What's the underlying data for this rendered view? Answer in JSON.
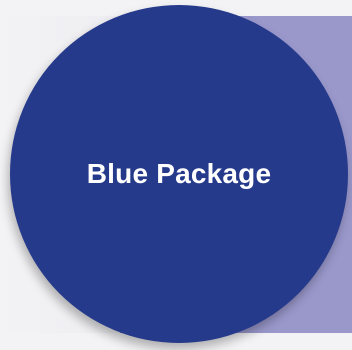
{
  "package": {
    "label": "Blue Package"
  },
  "colors": {
    "circle": "#263a8c",
    "backdrop": "#9a98cb",
    "page": "#f3f3f5",
    "text": "#ffffff"
  }
}
